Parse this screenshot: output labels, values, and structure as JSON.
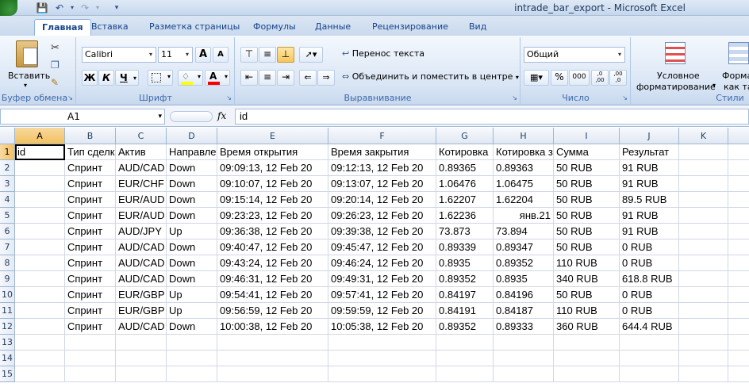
{
  "window": {
    "title": "intrade_bar_export - Microsoft Excel"
  },
  "tabs": [
    "Главная",
    "Вставка",
    "Разметка страницы",
    "Формулы",
    "Данные",
    "Рецензирование",
    "Вид"
  ],
  "ribbon": {
    "clipboard": {
      "paste_label": "Вставить",
      "group_label": "Буфер обмена"
    },
    "font": {
      "name": "Calibri",
      "size": "11",
      "bold": "Ж",
      "italic": "К",
      "underline": "Ч",
      "grow": "A",
      "shrink": "A",
      "color_letter": "A",
      "group_label": "Шрифт"
    },
    "alignment": {
      "wrap_label": "Перенос текста",
      "merge_label": "Объединить и поместить в центре",
      "group_label": "Выравнивание"
    },
    "number": {
      "format": "Общий",
      "percent": "%",
      "thousands": "000",
      "inc_dec": ",0 ,00",
      "dec_dec": ",00 ,0",
      "group_label": "Число"
    },
    "styles": {
      "cond_label_1": "Условное",
      "cond_label_2": "форматирование",
      "fmt_label_1": "Форма",
      "fmt_label_2": "как та",
      "group_label": "Стили"
    }
  },
  "formula_bar": {
    "name_box": "A1",
    "fx": "fx",
    "content": "id"
  },
  "sheet": {
    "columns": [
      "A",
      "B",
      "C",
      "D",
      "E",
      "F",
      "G",
      "H",
      "I",
      "J",
      "K"
    ],
    "row_numbers": [
      "1",
      "2",
      "3",
      "4",
      "5",
      "6",
      "7",
      "8",
      "9",
      "10",
      "11",
      "12",
      "13",
      "14",
      "15"
    ],
    "rows": [
      [
        "id",
        "Тип сделк",
        "Актив",
        "Направле",
        "Время открытия",
        "Время закрытия",
        "Котировка",
        "Котировка з",
        "Сумма",
        "Результат",
        ""
      ],
      [
        "",
        "Спринт",
        "AUD/CAD",
        "Down",
        "09:09:13, 12 Feb 20",
        "09:12:13, 12 Feb 20",
        "0.89365",
        "0.89363",
        "50 RUB",
        "91 RUB",
        ""
      ],
      [
        "",
        "Спринт",
        "EUR/CHF",
        "Down",
        "09:10:07, 12 Feb 20",
        "09:13:07, 12 Feb 20",
        "1.06476",
        "1.06475",
        "50 RUB",
        "91 RUB",
        ""
      ],
      [
        "",
        "Спринт",
        "EUR/AUD",
        "Down",
        "09:15:14, 12 Feb 20",
        "09:20:14, 12 Feb 20",
        "1.62207",
        "1.62204",
        "50 RUB",
        "89.5 RUB",
        ""
      ],
      [
        "",
        "Спринт",
        "EUR/AUD",
        "Down",
        "09:23:23, 12 Feb 20",
        "09:26:23, 12 Feb 20",
        "1.62236",
        "янв.21",
        "50 RUB",
        "91 RUB",
        ""
      ],
      [
        "",
        "Спринт",
        "AUD/JPY",
        "Up",
        "09:36:38, 12 Feb 20",
        "09:39:38, 12 Feb 20",
        "73.873",
        "73.894",
        "50 RUB",
        "91 RUB",
        ""
      ],
      [
        "",
        "Спринт",
        "AUD/CAD",
        "Down",
        "09:40:47, 12 Feb 20",
        "09:45:47, 12 Feb 20",
        "0.89339",
        "0.89347",
        "50 RUB",
        "0 RUB",
        ""
      ],
      [
        "",
        "Спринт",
        "AUD/CAD",
        "Down",
        "09:43:24, 12 Feb 20",
        "09:46:24, 12 Feb 20",
        "0.8935",
        "0.89352",
        "110 RUB",
        "0 RUB",
        ""
      ],
      [
        "",
        "Спринт",
        "AUD/CAD",
        "Down",
        "09:46:31, 12 Feb 20",
        "09:49:31, 12 Feb 20",
        "0.89352",
        "0.8935",
        "340 RUB",
        "618.8 RUB",
        ""
      ],
      [
        "",
        "Спринт",
        "EUR/GBP",
        "Up",
        "09:54:41, 12 Feb 20",
        "09:57:41, 12 Feb 20",
        "0.84197",
        "0.84196",
        "50 RUB",
        "0 RUB",
        ""
      ],
      [
        "",
        "Спринт",
        "EUR/GBP",
        "Up",
        "09:56:59, 12 Feb 20",
        "09:59:59, 12 Feb 20",
        "0.84191",
        "0.84187",
        "110 RUB",
        "0 RUB",
        ""
      ],
      [
        "",
        "Спринт",
        "AUD/CAD",
        "Down",
        "10:00:38, 12 Feb 20",
        "10:05:38, 12 Feb 20",
        "0.89352",
        "0.89333",
        "360 RUB",
        "644.4 RUB",
        ""
      ],
      [
        "",
        "",
        "",
        "",
        "",
        "",
        "",
        "",
        "",
        "",
        ""
      ],
      [
        "",
        "",
        "",
        "",
        "",
        "",
        "",
        "",
        "",
        "",
        ""
      ],
      [
        "",
        "",
        "",
        "",
        "",
        "",
        "",
        "",
        "",
        "",
        ""
      ]
    ]
  }
}
